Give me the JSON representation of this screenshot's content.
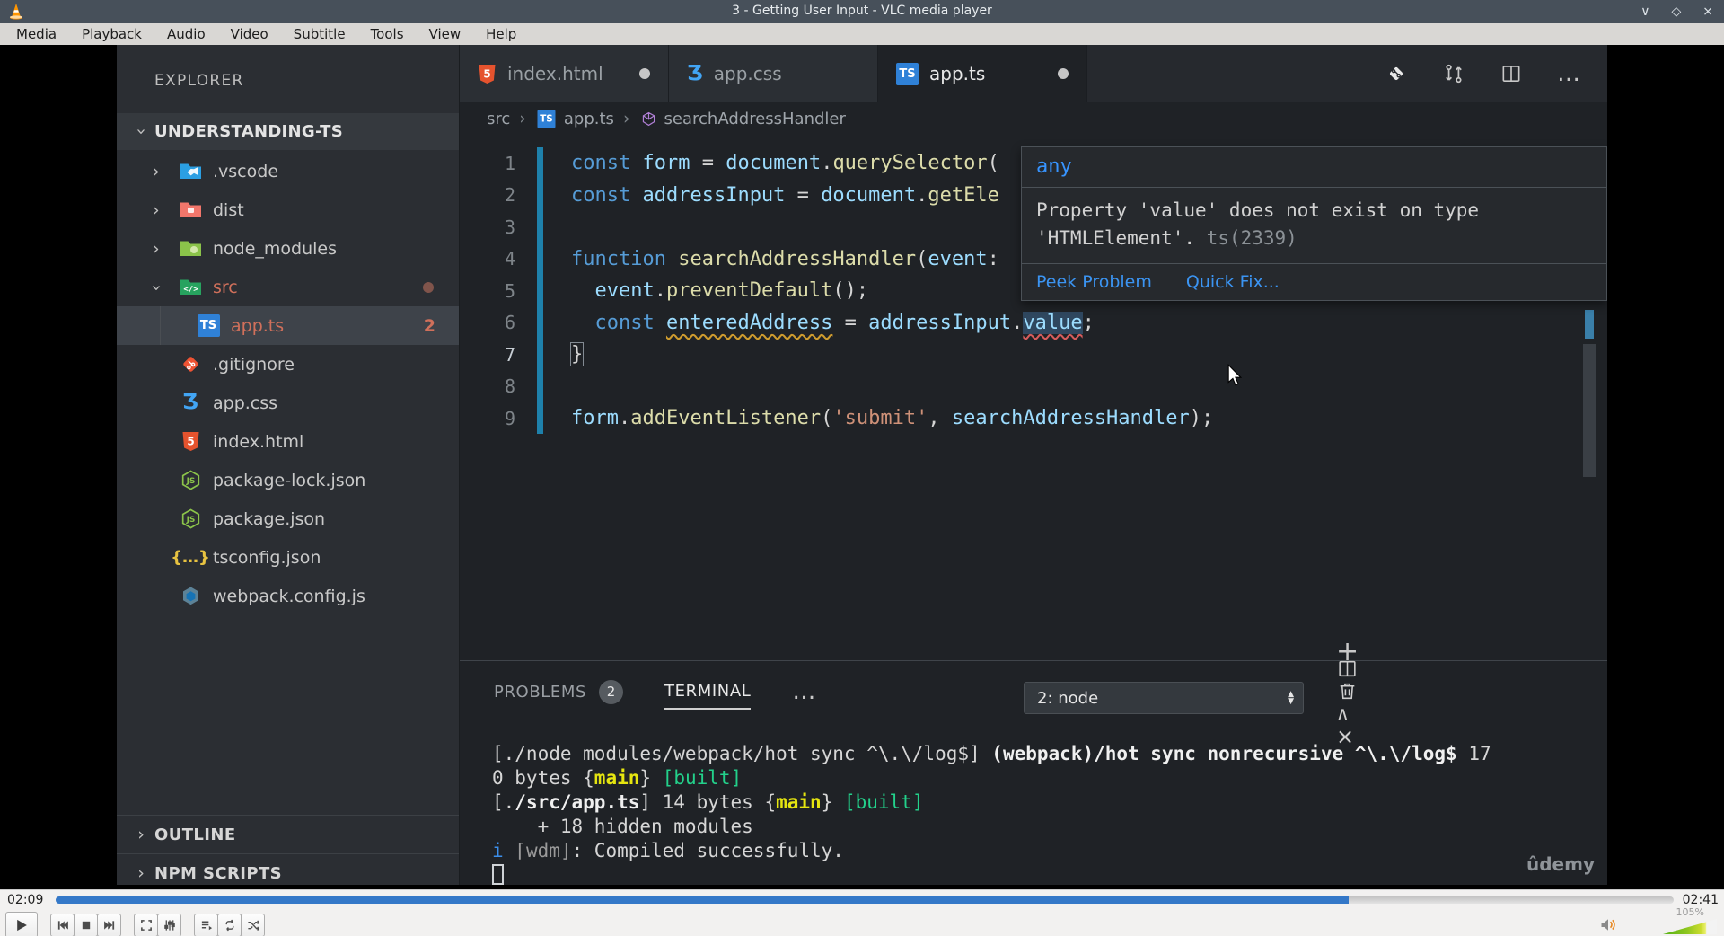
{
  "window": {
    "title": "3 - Getting User Input - VLC media player",
    "controls": [
      {
        "name": "minimize",
        "glyph": "∨"
      },
      {
        "name": "maximize",
        "glyph": "◇"
      },
      {
        "name": "close",
        "glyph": "×"
      }
    ]
  },
  "menu": [
    "Media",
    "Playback",
    "Audio",
    "Video",
    "Subtitle",
    "Tools",
    "View",
    "Help"
  ],
  "explorer": {
    "header": "EXPLORER",
    "workspace": "UNDERSTANDING-TS",
    "files": [
      {
        "label": ".vscode",
        "icon": "folder-vscode",
        "chevron": "right",
        "indent": 0
      },
      {
        "label": "dist",
        "icon": "folder-red",
        "chevron": "right",
        "indent": 0
      },
      {
        "label": "node_modules",
        "icon": "folder-green",
        "chevron": "right",
        "indent": 0
      },
      {
        "label": "src",
        "icon": "folder-src",
        "chevron": "down",
        "indent": 0,
        "cls": "modified",
        "dot": true
      },
      {
        "label": "app.ts",
        "icon": "ts",
        "indent": 1,
        "cls": "modified selected",
        "badge": "2"
      },
      {
        "label": ".gitignore",
        "icon": "git",
        "indent": 0
      },
      {
        "label": "app.css",
        "icon": "css",
        "indent": 0
      },
      {
        "label": "index.html",
        "icon": "html",
        "indent": 0
      },
      {
        "label": "package-lock.json",
        "icon": "node",
        "indent": 0
      },
      {
        "label": "package.json",
        "icon": "node",
        "indent": 0
      },
      {
        "label": "tsconfig.json",
        "icon": "braces",
        "indent": 0
      },
      {
        "label": "webpack.config.js",
        "icon": "webpack",
        "indent": 0
      }
    ],
    "sections": [
      "OUTLINE",
      "NPM SCRIPTS"
    ]
  },
  "tabs": [
    {
      "label": "index.html",
      "icon": "html",
      "dot": true,
      "active": false
    },
    {
      "label": "app.css",
      "icon": "css",
      "dot": false,
      "active": false
    },
    {
      "label": "app.ts",
      "icon": "ts",
      "dot": true,
      "active": true
    }
  ],
  "editor_actions": [
    "open-changes",
    "compare",
    "split-editor",
    "more-actions"
  ],
  "breadcrumb": [
    {
      "label": "src",
      "icon": null
    },
    {
      "label": "app.ts",
      "icon": "ts"
    },
    {
      "label": "searchAddressHandler",
      "icon": "symbol-function"
    }
  ],
  "code_lines": [
    {
      "n": 1,
      "tokens": [
        [
          "kw",
          "const"
        ],
        [
          "pun",
          " "
        ],
        [
          "var",
          "form"
        ],
        [
          "pun",
          " = "
        ],
        [
          "var",
          "document"
        ],
        [
          "pun",
          "."
        ],
        [
          "fn",
          "querySelector"
        ],
        [
          "pun",
          "("
        ]
      ]
    },
    {
      "n": 2,
      "tokens": [
        [
          "kw",
          "const"
        ],
        [
          "pun",
          " "
        ],
        [
          "var",
          "addressInput"
        ],
        [
          "pun",
          " = "
        ],
        [
          "var",
          "document"
        ],
        [
          "pun",
          "."
        ],
        [
          "fn",
          "getEle"
        ]
      ]
    },
    {
      "n": 3,
      "tokens": []
    },
    {
      "n": 4,
      "tokens": [
        [
          "kw",
          "function"
        ],
        [
          "pun",
          " "
        ],
        [
          "fn",
          "searchAddressHandler"
        ],
        [
          "pun",
          "("
        ],
        [
          "var",
          "event"
        ],
        [
          "pun",
          ":"
        ]
      ]
    },
    {
      "n": 5,
      "tokens": [
        [
          "pun",
          "  "
        ],
        [
          "var",
          "event"
        ],
        [
          "pun",
          "."
        ],
        [
          "fn",
          "preventDefault"
        ],
        [
          "pun",
          "();"
        ]
      ]
    },
    {
      "n": 6,
      "tokens": [
        [
          "pun",
          "  "
        ],
        [
          "kw",
          "const"
        ],
        [
          "pun",
          " "
        ],
        [
          "warn",
          "enteredAddress"
        ],
        [
          "pun",
          " = "
        ],
        [
          "var",
          "addressInput"
        ],
        [
          "pun",
          "."
        ],
        [
          "err",
          "value"
        ],
        [
          "pun",
          ";"
        ]
      ]
    },
    {
      "n": 7,
      "active": true,
      "tokens": [
        [
          "bracket",
          "}"
        ]
      ]
    },
    {
      "n": 8,
      "tokens": []
    },
    {
      "n": 9,
      "tokens": [
        [
          "var",
          "form"
        ],
        [
          "pun",
          "."
        ],
        [
          "fn",
          "addEventListener"
        ],
        [
          "pun",
          "("
        ],
        [
          "str",
          "'submit'"
        ],
        [
          "pun",
          ", "
        ],
        [
          "var",
          "searchAddressHandler"
        ],
        [
          "pun",
          ");"
        ]
      ]
    }
  ],
  "tooltip": {
    "type": "any",
    "message": "Property 'value' does not exist on type 'HTMLElement'.",
    "code": "ts(2339)",
    "actions": [
      "Peek Problem",
      "Quick Fix..."
    ]
  },
  "panel": {
    "tabs": [
      {
        "label": "PROBLEMS",
        "badge": "2",
        "active": false
      },
      {
        "label": "TERMINAL",
        "active": true
      }
    ],
    "dropdown": "2: node",
    "icons": [
      "new-terminal",
      "split-terminal",
      "kill-terminal",
      "maximize-panel",
      "close-panel"
    ]
  },
  "terminal": {
    "lines": [
      [
        [
          "n",
          "[./node_modules/webpack/hot sync ^\\.\\/log$] "
        ],
        [
          "b",
          "(webpack)/hot sync nonrecursive ^\\.\\/log$"
        ],
        [
          "n",
          " 17"
        ]
      ],
      [
        [
          "n",
          "0 bytes {"
        ],
        [
          "y",
          "main"
        ],
        [
          "n",
          "} "
        ],
        [
          "g",
          "[built]"
        ]
      ],
      [
        [
          "n",
          "[."
        ],
        [
          "b",
          "/src/app.ts"
        ],
        [
          "n",
          "] 14 bytes {"
        ],
        [
          "y",
          "main"
        ],
        [
          "n",
          "} "
        ],
        [
          "g",
          "[built]"
        ]
      ],
      [
        [
          "n",
          "    + 18 hidden modules"
        ]
      ],
      [
        [
          "i",
          "i"
        ],
        [
          "d",
          " ⌈wdm⌋"
        ],
        [
          "n",
          ": Compiled successfully."
        ]
      ]
    ],
    "watermark": "ûdemy"
  },
  "vlc": {
    "elapsed": "02:09",
    "total": "02:41",
    "progress": 0.799,
    "volume": "105%",
    "buttons": [
      "play",
      "previous",
      "stop",
      "next",
      "fullscreen",
      "extended-settings",
      "playlist",
      "loop",
      "random"
    ]
  },
  "colors": {
    "accent_blue": "#3478c8",
    "modified_orange": "#d0705b",
    "gutter_modified": "#1e81ab",
    "link_blue": "#3794ff",
    "built_green": "#23d18b",
    "chunk_yellow": "#e5e510"
  }
}
